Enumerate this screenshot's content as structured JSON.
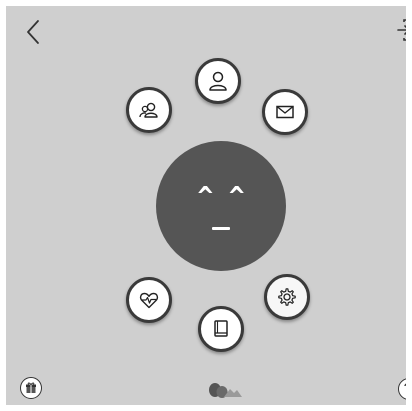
{
  "face": {
    "eyes": "^ ^"
  },
  "icons": {
    "back": "chevron-left-icon",
    "logout": "logout-icon",
    "profile": "user-icon",
    "friends": "users-icon",
    "mail": "mail-icon",
    "health": "heart-pulse-icon",
    "journal": "book-icon",
    "settings": "gear-icon",
    "bottom_left": "gift-icon",
    "bottom_right": "help-icon",
    "logo": "mascot-logo"
  },
  "colors": {
    "background": "#cfcfcf",
    "face": "#555555",
    "button_fill": "#ffffff",
    "button_border": "#3a3a3a"
  }
}
